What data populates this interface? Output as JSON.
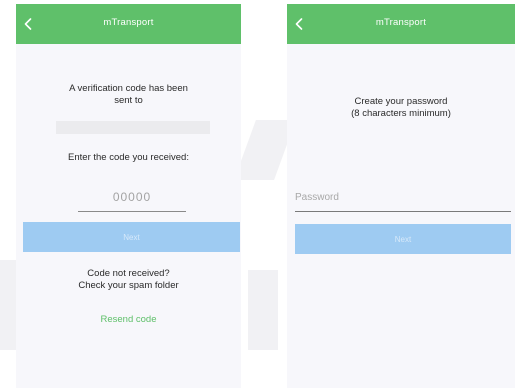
{
  "screens": [
    {
      "header": {
        "title": "mTransport",
        "back_icon": "chevron-left-icon"
      },
      "message_line1": "A verification code has been",
      "message_line2": "sent to",
      "prompt": "Enter the code you received:",
      "code_input": {
        "placeholder": "00000",
        "value": ""
      },
      "button_label": "Next",
      "not_received_line1": "Code not received?",
      "not_received_line2": "Check your spam folder",
      "resend_link": "Resend code"
    },
    {
      "header": {
        "title": "mTransport",
        "back_icon": "chevron-left-icon"
      },
      "heading_line1": "Create your password",
      "heading_line2": "(8 characters minimum)",
      "password_input": {
        "placeholder": "Password",
        "value": ""
      },
      "button_label": "Next"
    }
  ],
  "colors": {
    "header": "#5fc06a",
    "button_disabled": "#9ecbf2",
    "link": "#5fc06a",
    "screen_background": "#f7f7fb"
  }
}
